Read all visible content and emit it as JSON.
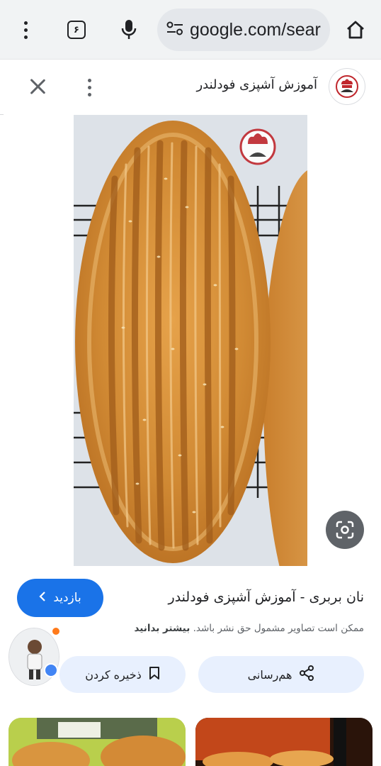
{
  "browser": {
    "url": "google.com/sear",
    "tab_count": "۶",
    "icons": [
      "menu-kebab-icon",
      "tab-switcher-icon",
      "microphone-icon",
      "site-settings-icon",
      "home-icon"
    ]
  },
  "panel": {
    "site_name": "آموزش آشپزی فودلندر",
    "icons": [
      "close-icon",
      "more-options-icon",
      "site-logo-icon"
    ]
  },
  "image": {
    "subject": "نان بربری",
    "lens_icon": "google-lens-icon"
  },
  "result": {
    "visit_label": "بازدید",
    "title": "نان بربری - آموزش آشپزی فودلندر",
    "copyright_text": "ممکن است تصاویر مشمول حق نشر باشد.",
    "learn_more": "بیشتر بدانید",
    "share_label": "هم‌رسانی",
    "save_label": "ذخیره کردن"
  },
  "colors": {
    "accent": "#1a73e8",
    "pill_bg": "#e8f0fe",
    "toolbar_bg": "#f1f3f4",
    "notification_dot": "#ff7a1a"
  }
}
